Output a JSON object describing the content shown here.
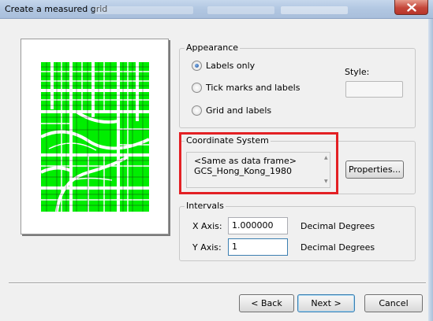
{
  "window": {
    "title": "Create a measured grid"
  },
  "appearance": {
    "label": "Appearance",
    "options": [
      {
        "label": "Labels only",
        "checked": true
      },
      {
        "label": "Tick marks and labels",
        "checked": false
      },
      {
        "label": "Grid and labels",
        "checked": false
      }
    ],
    "style_label": "Style:",
    "style_value": ""
  },
  "coordinate_system": {
    "label": "Coordinate System",
    "lines": [
      "<Same as data frame>",
      "GCS_Hong_Kong_1980"
    ],
    "properties_button": "Properties..."
  },
  "intervals": {
    "label": "Intervals",
    "x_label": "X Axis:",
    "x_value": "1.000000",
    "x_unit": "Decimal Degrees",
    "y_label": "Y Axis:",
    "y_value": "1",
    "y_unit": "Decimal Degrees"
  },
  "buttons": {
    "back": "< Back",
    "next": "Next >",
    "cancel": "Cancel"
  },
  "colors": {
    "map_fill": "#00ee00",
    "highlight": "#e32024",
    "close_button": "#c5473a"
  },
  "icons": {
    "close": "close-icon",
    "scroll_up": "scroll-up-icon",
    "scroll_down": "scroll-down-icon"
  }
}
